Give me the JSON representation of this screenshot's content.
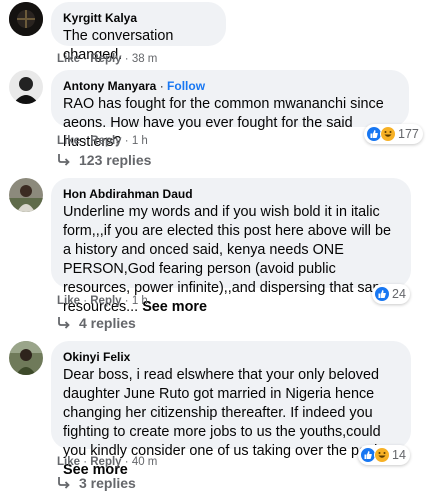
{
  "comments": [
    {
      "author": "Kyrgitt Kalya",
      "text": "The conversation changed.",
      "like_label": "Like",
      "reply_label": "Reply",
      "time": "38 m"
    },
    {
      "author": "Antony Manyara",
      "follow_label": "Follow",
      "text": "RAO has fought for the common mwananchi since aeons. How have you ever fought for the said hustlers?",
      "like_label": "Like",
      "reply_label": "Reply",
      "time": "1 h",
      "reaction_count": "177",
      "reactions": [
        "like-icon",
        "haha-icon"
      ],
      "replies_label": "123 replies"
    },
    {
      "author": "Hon Abdirahman Daud",
      "text": "Underline my words and if you wish bold it in italic form,,,if you are elected this post here above will be a history and onced said, kenya needs ONE PERSON,God fearing person (avoid public resources, power infinite),,and dispersing that same resources...",
      "see_more": "See more",
      "like_label": "Like",
      "reply_label": "Reply",
      "time": "1 h",
      "reaction_count": "24",
      "reactions": [
        "like-icon"
      ],
      "replies_label": "4 replies"
    },
    {
      "author": "Okinyi Felix",
      "text": "Dear boss, i read elswhere that your only beloved daughter June Ruto got married in Nigeria hence changing her citizenship thereafter. If indeed you fighting to create more jobs to us the youths,could you kindly consider one of us taking over the posit...",
      "see_more": "See more",
      "like_label": "Like",
      "reply_label": "Reply",
      "time": "40 m",
      "reaction_count": "14",
      "reactions": [
        "like-icon",
        "haha-icon"
      ],
      "replies_label": "3 replies"
    }
  ],
  "colors": {
    "bubble": "#f0f2f5",
    "link": "#1877f2",
    "meta": "#65676b",
    "like": "#1877f2",
    "haha": "#f7b125"
  }
}
